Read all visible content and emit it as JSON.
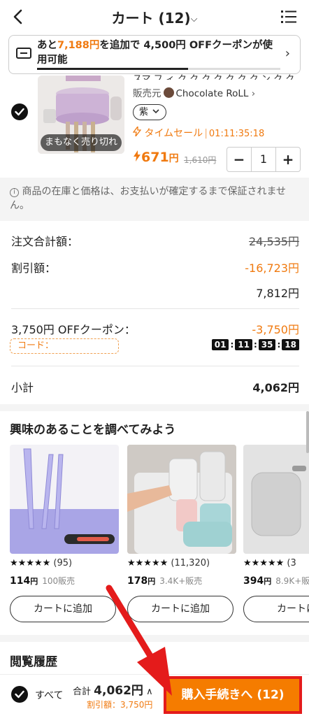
{
  "header": {
    "title": "カート (12)",
    "chevron": "⌵"
  },
  "coupon_banner": {
    "pre": "あと",
    "amount": "7,188円",
    "post": "を追加で 4,500円 OFFクーポンが使用可能",
    "arrow": "›",
    "progress_fraction": 0.62
  },
  "product": {
    "name_fragment": "スマ フ ィ ク ク ク ク ク ク ク ン ク ク フ ",
    "sold_out_label": "まもなく売り切れ",
    "seller_label": "販売元",
    "shop_name": "Chocolate RoLL",
    "shop_arrow": "›",
    "variant": "紫",
    "sale_label": "タイムセール",
    "sale_timer": "01:11:35:18",
    "price": "671",
    "price_unit": "円",
    "original_price": "1,610円",
    "quantity": "1",
    "minus": "−",
    "plus": "+"
  },
  "notice": {
    "text": "商品の在庫と価格は、お支払いが確定するまで保証されません。"
  },
  "summary": {
    "order_total_label": "注文合計額：",
    "order_total_value": "24,535円",
    "discount_label": "割引額：",
    "discount_value": "-16,723円",
    "after_discount": "7,812円",
    "coupon_label": "3,750円 OFFクーポン：",
    "coupon_value": "-3,750円",
    "code_label": "コード：",
    "countdown": [
      "01",
      "11",
      "35",
      "18"
    ],
    "subtotal_label": "小計",
    "subtotal_value": "4,062円"
  },
  "recommendations": {
    "title": "興味のあることを調べてみよう",
    "items": [
      {
        "stars": "★★★★★",
        "count": "(95)",
        "price": "114",
        "unit": "円",
        "sold": "100販売",
        "add_label": "カートに追加"
      },
      {
        "stars": "★★★★★",
        "count": "(11,320)",
        "price": "178",
        "unit": "円",
        "sold": "3.4K+販売",
        "add_label": "カートに追加"
      },
      {
        "stars": "★★★★★",
        "count": "(3",
        "price": "394",
        "unit": "円",
        "sold": "8.9K+販",
        "add_label": "カートに"
      }
    ]
  },
  "history": {
    "title": "閲覧履歴"
  },
  "bottom_bar": {
    "select_all": "すべて",
    "total_label": "合計",
    "total_value": "4,062円",
    "expand": "∧",
    "discount_text": "割引額：3,750円",
    "checkout_label": "購入手続きへ (12)"
  },
  "colors": {
    "accent": "#f07a10",
    "checkout": "#f57c00",
    "highlight": "#e41b1b"
  },
  "icons": [
    "back-arrow-icon",
    "chevron-down-icon",
    "list-menu-icon",
    "coupon-ticket-icon",
    "chevron-right-icon",
    "checkmark-icon",
    "lightning-icon",
    "info-icon",
    "star-icon",
    "red-arrow-annotation"
  ]
}
